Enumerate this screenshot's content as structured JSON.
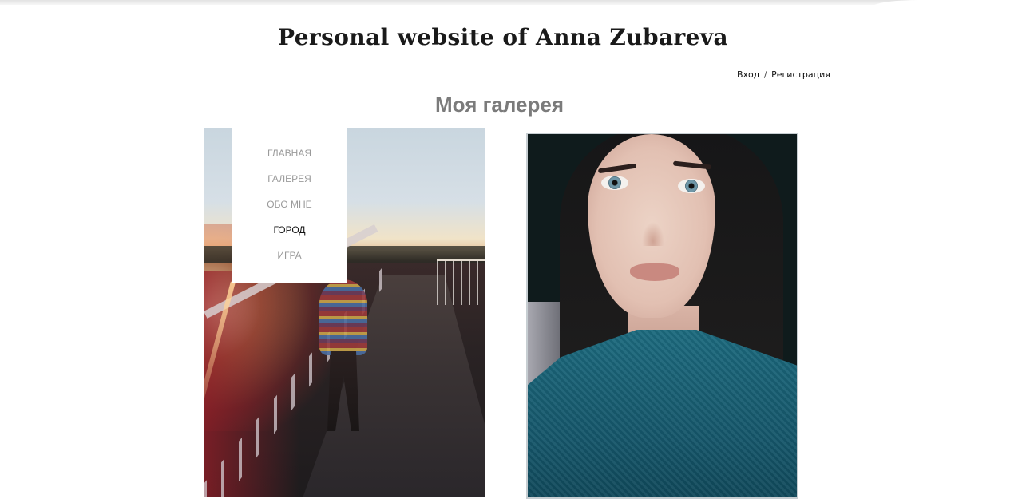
{
  "header": {
    "site_title": "Personal website of Anna Zubareva"
  },
  "auth": {
    "login_label": "Вход",
    "separator": "/",
    "register_label": "Регистрация"
  },
  "main": {
    "gallery_title": "Моя галерея"
  },
  "nav": {
    "items": [
      {
        "label": "ГЛАВНАЯ",
        "active": false
      },
      {
        "label": "ГАЛЕРЕЯ",
        "active": false
      },
      {
        "label": "ОБО МНЕ",
        "active": false
      },
      {
        "label": "ГОРОД",
        "active": true
      },
      {
        "label": "ИГРА",
        "active": false
      }
    ]
  },
  "colors": {
    "background": "#ffffff",
    "title_text": "#1a1a1a",
    "gallery_title": "#7b7b7b",
    "nav_text": "#9a9a9a",
    "nav_active": "#111111"
  }
}
